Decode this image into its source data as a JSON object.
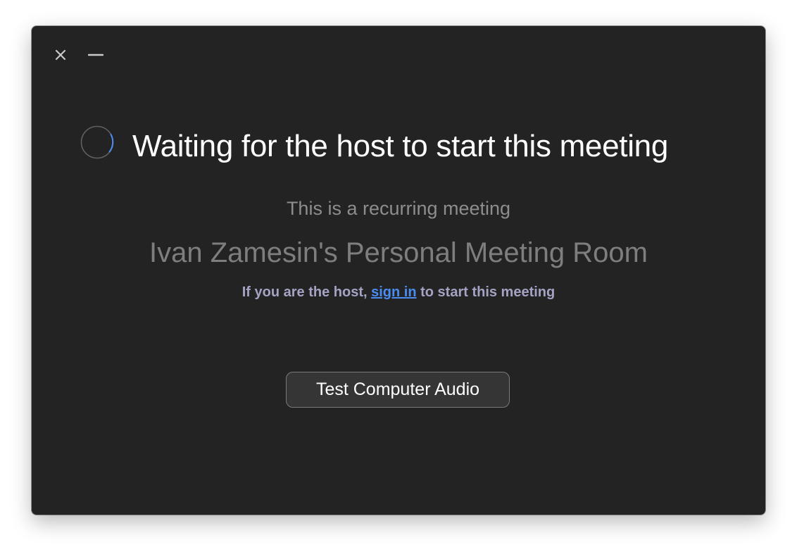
{
  "window": {
    "close_icon": "close-icon",
    "minimize_icon": "minimize-icon"
  },
  "main": {
    "spinner_icon": "loading-spinner-icon",
    "title": "Waiting for the host to start this meeting",
    "recurring_text": "This is a recurring meeting",
    "room_name": "Ivan Zamesin's Personal Meeting Room",
    "host_prefix": "If you are the host, ",
    "sign_in_link": "sign in",
    "host_suffix": " to start this meeting",
    "test_audio_button": "Test Computer Audio"
  },
  "colors": {
    "window_bg": "#232323",
    "link": "#4a8cf2",
    "spinner_accent": "#4a8cf2",
    "secondary_text": "#8d8d8d",
    "host_text": "#a4a3c4"
  }
}
